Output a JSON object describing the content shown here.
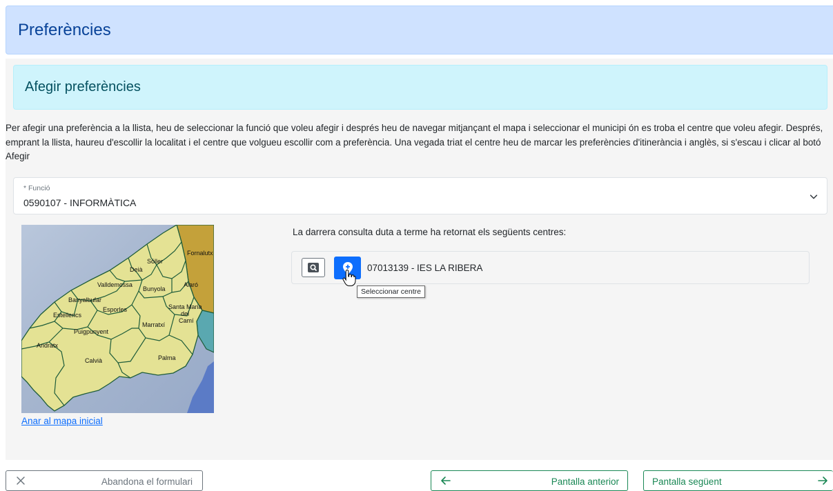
{
  "page": {
    "title": "Preferències"
  },
  "section": {
    "title": "Afegir preferències"
  },
  "instructions": "Per afegir una preferència a la llista, heu de seleccionar la funció que voleu afegir i després heu de navegar mitjançant el mapa i seleccionar el municipi ón es troba el centre que voleu afegir. Després, emprant la llista, haureu d'escollir la localitat i el centre que volgueu escollir com a preferència. Una vegada triat el centre heu de marcar les preferències d'itinerància i anglès, si s'escau i clicar al botó Afegir",
  "funcio": {
    "label": "* Funció",
    "value": "0590107 - INFORMÀTICA"
  },
  "map": {
    "link_label": "Anar al mapa inicial",
    "municipalities": [
      "Fornalutx",
      "Sóller",
      "Deià",
      "Valldemossa",
      "Bunyola",
      "Alaró",
      "Banyalbufar",
      "Esporles",
      "Santa Maria",
      "del",
      "Camí",
      "Estellencs",
      "Marratxí",
      "Puigpunyent",
      "Andratx",
      "Calvià",
      "Palma"
    ]
  },
  "results": {
    "intro": "La darrera consulta duta a terme ha retornat els següents centres:",
    "items": [
      {
        "name": "07013139 - IES LA RIBERA"
      }
    ],
    "tooltip": "Seleccionar centre"
  },
  "footer": {
    "abandon_label": "Abandona el formulari",
    "prev_label": "Pantalla anterior",
    "next_label": "Pantalla següent"
  },
  "colors": {
    "primary": "#0d6efd",
    "success": "#198754",
    "header_bg": "#cfe2ff",
    "section_bg": "#cff4fc"
  },
  "icons": {
    "view": "magnifier-icon",
    "select": "map-pin-plus-icon",
    "chevron": "chevron-down-icon"
  }
}
